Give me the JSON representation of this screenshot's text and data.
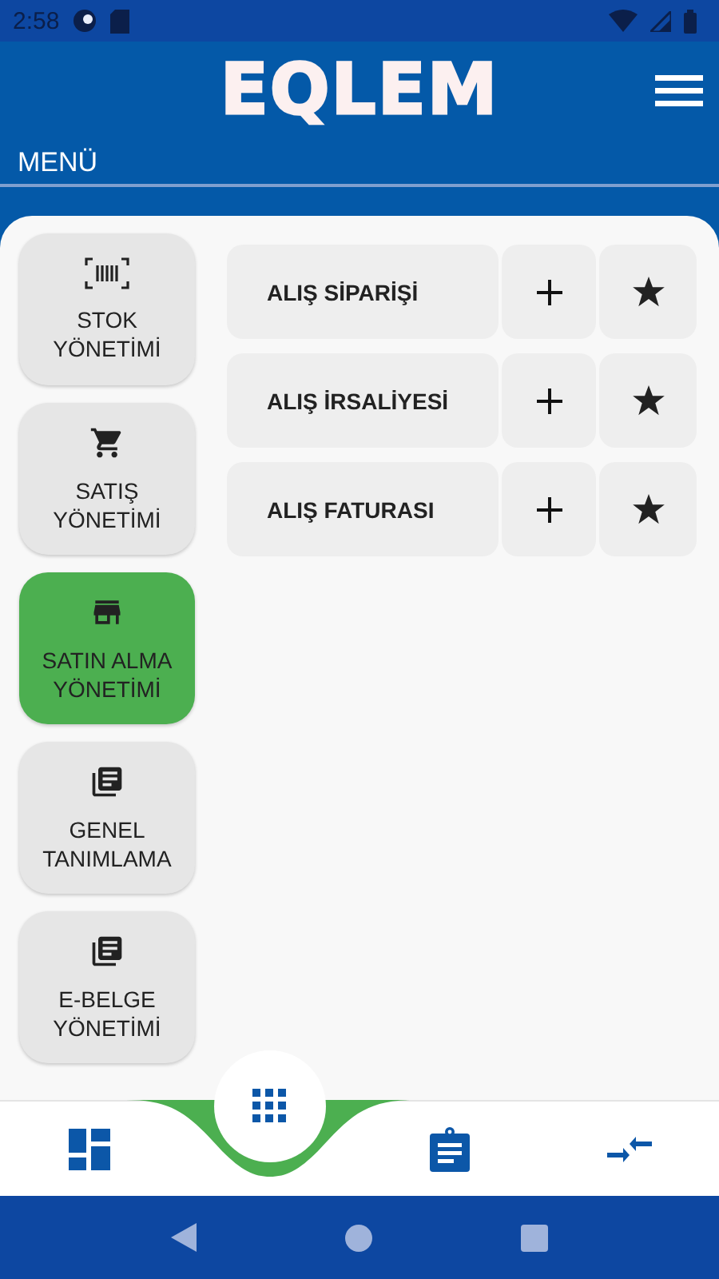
{
  "status_bar": {
    "time": "2:58"
  },
  "header": {
    "title": "EQLEM",
    "section": "MENÜ"
  },
  "categories": [
    {
      "label": "STOK YÖNETİMİ",
      "selected": false
    },
    {
      "label": "SATIŞ YÖNETİMİ",
      "selected": false
    },
    {
      "label": "SATIN ALMA YÖNETİMİ",
      "selected": true
    },
    {
      "label": "GENEL TANIMLAMA",
      "selected": false
    },
    {
      "label": "E-BELGE YÖNETİMİ",
      "selected": false
    }
  ],
  "actions": [
    {
      "label": "ALIŞ SİPARİŞİ"
    },
    {
      "label": "ALIŞ İRSALİYESİ"
    },
    {
      "label": "ALIŞ FATURASI"
    }
  ],
  "bottom_nav": [
    {
      "selected": false
    },
    {
      "selected": true
    },
    {
      "selected": false
    },
    {
      "selected": false
    }
  ]
}
